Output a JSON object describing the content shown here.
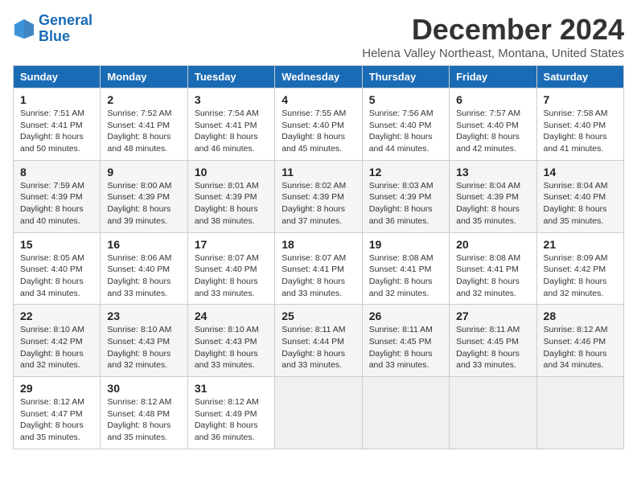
{
  "logo": {
    "line1": "General",
    "line2": "Blue"
  },
  "title": "December 2024",
  "location": "Helena Valley Northeast, Montana, United States",
  "headers": [
    "Sunday",
    "Monday",
    "Tuesday",
    "Wednesday",
    "Thursday",
    "Friday",
    "Saturday"
  ],
  "weeks": [
    [
      {
        "day": "1",
        "sunrise": "Sunrise: 7:51 AM",
        "sunset": "Sunset: 4:41 PM",
        "daylight": "Daylight: 8 hours and 50 minutes."
      },
      {
        "day": "2",
        "sunrise": "Sunrise: 7:52 AM",
        "sunset": "Sunset: 4:41 PM",
        "daylight": "Daylight: 8 hours and 48 minutes."
      },
      {
        "day": "3",
        "sunrise": "Sunrise: 7:54 AM",
        "sunset": "Sunset: 4:41 PM",
        "daylight": "Daylight: 8 hours and 46 minutes."
      },
      {
        "day": "4",
        "sunrise": "Sunrise: 7:55 AM",
        "sunset": "Sunset: 4:40 PM",
        "daylight": "Daylight: 8 hours and 45 minutes."
      },
      {
        "day": "5",
        "sunrise": "Sunrise: 7:56 AM",
        "sunset": "Sunset: 4:40 PM",
        "daylight": "Daylight: 8 hours and 44 minutes."
      },
      {
        "day": "6",
        "sunrise": "Sunrise: 7:57 AM",
        "sunset": "Sunset: 4:40 PM",
        "daylight": "Daylight: 8 hours and 42 minutes."
      },
      {
        "day": "7",
        "sunrise": "Sunrise: 7:58 AM",
        "sunset": "Sunset: 4:40 PM",
        "daylight": "Daylight: 8 hours and 41 minutes."
      }
    ],
    [
      {
        "day": "8",
        "sunrise": "Sunrise: 7:59 AM",
        "sunset": "Sunset: 4:39 PM",
        "daylight": "Daylight: 8 hours and 40 minutes."
      },
      {
        "day": "9",
        "sunrise": "Sunrise: 8:00 AM",
        "sunset": "Sunset: 4:39 PM",
        "daylight": "Daylight: 8 hours and 39 minutes."
      },
      {
        "day": "10",
        "sunrise": "Sunrise: 8:01 AM",
        "sunset": "Sunset: 4:39 PM",
        "daylight": "Daylight: 8 hours and 38 minutes."
      },
      {
        "day": "11",
        "sunrise": "Sunrise: 8:02 AM",
        "sunset": "Sunset: 4:39 PM",
        "daylight": "Daylight: 8 hours and 37 minutes."
      },
      {
        "day": "12",
        "sunrise": "Sunrise: 8:03 AM",
        "sunset": "Sunset: 4:39 PM",
        "daylight": "Daylight: 8 hours and 36 minutes."
      },
      {
        "day": "13",
        "sunrise": "Sunrise: 8:04 AM",
        "sunset": "Sunset: 4:39 PM",
        "daylight": "Daylight: 8 hours and 35 minutes."
      },
      {
        "day": "14",
        "sunrise": "Sunrise: 8:04 AM",
        "sunset": "Sunset: 4:40 PM",
        "daylight": "Daylight: 8 hours and 35 minutes."
      }
    ],
    [
      {
        "day": "15",
        "sunrise": "Sunrise: 8:05 AM",
        "sunset": "Sunset: 4:40 PM",
        "daylight": "Daylight: 8 hours and 34 minutes."
      },
      {
        "day": "16",
        "sunrise": "Sunrise: 8:06 AM",
        "sunset": "Sunset: 4:40 PM",
        "daylight": "Daylight: 8 hours and 33 minutes."
      },
      {
        "day": "17",
        "sunrise": "Sunrise: 8:07 AM",
        "sunset": "Sunset: 4:40 PM",
        "daylight": "Daylight: 8 hours and 33 minutes."
      },
      {
        "day": "18",
        "sunrise": "Sunrise: 8:07 AM",
        "sunset": "Sunset: 4:41 PM",
        "daylight": "Daylight: 8 hours and 33 minutes."
      },
      {
        "day": "19",
        "sunrise": "Sunrise: 8:08 AM",
        "sunset": "Sunset: 4:41 PM",
        "daylight": "Daylight: 8 hours and 32 minutes."
      },
      {
        "day": "20",
        "sunrise": "Sunrise: 8:08 AM",
        "sunset": "Sunset: 4:41 PM",
        "daylight": "Daylight: 8 hours and 32 minutes."
      },
      {
        "day": "21",
        "sunrise": "Sunrise: 8:09 AM",
        "sunset": "Sunset: 4:42 PM",
        "daylight": "Daylight: 8 hours and 32 minutes."
      }
    ],
    [
      {
        "day": "22",
        "sunrise": "Sunrise: 8:10 AM",
        "sunset": "Sunset: 4:42 PM",
        "daylight": "Daylight: 8 hours and 32 minutes."
      },
      {
        "day": "23",
        "sunrise": "Sunrise: 8:10 AM",
        "sunset": "Sunset: 4:43 PM",
        "daylight": "Daylight: 8 hours and 32 minutes."
      },
      {
        "day": "24",
        "sunrise": "Sunrise: 8:10 AM",
        "sunset": "Sunset: 4:43 PM",
        "daylight": "Daylight: 8 hours and 33 minutes."
      },
      {
        "day": "25",
        "sunrise": "Sunrise: 8:11 AM",
        "sunset": "Sunset: 4:44 PM",
        "daylight": "Daylight: 8 hours and 33 minutes."
      },
      {
        "day": "26",
        "sunrise": "Sunrise: 8:11 AM",
        "sunset": "Sunset: 4:45 PM",
        "daylight": "Daylight: 8 hours and 33 minutes."
      },
      {
        "day": "27",
        "sunrise": "Sunrise: 8:11 AM",
        "sunset": "Sunset: 4:45 PM",
        "daylight": "Daylight: 8 hours and 33 minutes."
      },
      {
        "day": "28",
        "sunrise": "Sunrise: 8:12 AM",
        "sunset": "Sunset: 4:46 PM",
        "daylight": "Daylight: 8 hours and 34 minutes."
      }
    ],
    [
      {
        "day": "29",
        "sunrise": "Sunrise: 8:12 AM",
        "sunset": "Sunset: 4:47 PM",
        "daylight": "Daylight: 8 hours and 35 minutes."
      },
      {
        "day": "30",
        "sunrise": "Sunrise: 8:12 AM",
        "sunset": "Sunset: 4:48 PM",
        "daylight": "Daylight: 8 hours and 35 minutes."
      },
      {
        "day": "31",
        "sunrise": "Sunrise: 8:12 AM",
        "sunset": "Sunset: 4:49 PM",
        "daylight": "Daylight: 8 hours and 36 minutes."
      },
      null,
      null,
      null,
      null
    ]
  ]
}
